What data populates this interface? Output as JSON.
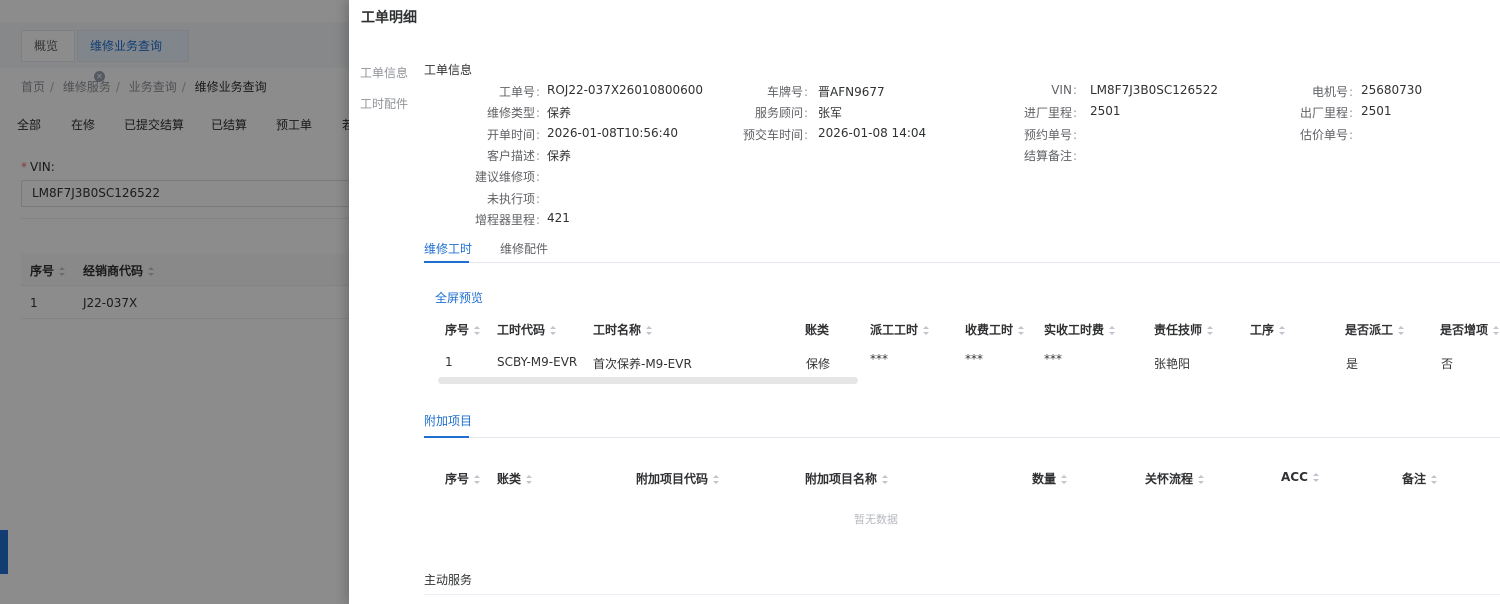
{
  "background": {
    "tabs": [
      {
        "label": "概览"
      },
      {
        "label": "维修业务查询"
      }
    ],
    "breadcrumb": [
      "首页",
      "维修服务",
      "业务查询",
      "维修业务查询"
    ],
    "status_tabs": [
      "全部",
      "在修",
      "已提交结算",
      "已结算",
      "预工单",
      "若"
    ],
    "vin_label": "VIN:",
    "vin_value": "LM8F7J3B0SC126522",
    "table": {
      "headers": [
        "序号",
        "经销商代码"
      ],
      "row": [
        "1",
        "J22-037X"
      ]
    }
  },
  "drawer": {
    "title": "工单明细",
    "nav": [
      "工单信息",
      "工时配件"
    ],
    "section_title": "工单信息",
    "fields": {
      "order_no": {
        "label": "工单号",
        "value": "ROJ22-037X26010800600"
      },
      "plate": {
        "label": "车牌号",
        "value": "晋AFN9677"
      },
      "vin": {
        "label": "VIN",
        "value": "LM8F7J3B0SC126522"
      },
      "motor_no": {
        "label": "电机号",
        "value": "25680730"
      },
      "repair_type": {
        "label": "维修类型",
        "value": "保养"
      },
      "advisor": {
        "label": "服务顾问",
        "value": "张军"
      },
      "in_mileage": {
        "label": "进厂里程",
        "value": "2501"
      },
      "out_mileage": {
        "label": "出厂里程",
        "value": "2501"
      },
      "open_time": {
        "label": "开单时间",
        "value": "2026-01-08T10:56:40"
      },
      "delivery_time": {
        "label": "预交车时间",
        "value": "2026-01-08 14:04"
      },
      "booking_no": {
        "label": "预约单号",
        "value": ""
      },
      "estimate_no": {
        "label": "估价单号",
        "value": ""
      },
      "customer_desc": {
        "label": "客户描述",
        "value": "保养"
      },
      "settle_note": {
        "label": "结算备注",
        "value": ""
      },
      "suggest_item": {
        "label": "建议维修项",
        "value": ""
      },
      "unexecuted": {
        "label": "未执行项",
        "value": ""
      },
      "range_extender": {
        "label": "增程器里程",
        "value": "421"
      }
    },
    "tabs": [
      "维修工时",
      "维修配件"
    ],
    "fullscreen_link": "全屏预览",
    "labor_table": {
      "headers": [
        "序号",
        "工时代码",
        "工时名称",
        "账类",
        "派工工时",
        "收费工时",
        "实收工时费",
        "责任技师",
        "工序",
        "是否派工",
        "是否增项"
      ],
      "rows": [
        [
          "1",
          "SCBY-M9-EVR",
          "首次保养-M9-EVR",
          "保修",
          "***",
          "***",
          "***",
          "张艳阳",
          "",
          "是",
          "否"
        ]
      ]
    },
    "addon": {
      "title": "附加项目",
      "headers": [
        "序号",
        "账类",
        "附加项目代码",
        "附加项目名称",
        "数量",
        "关怀流程",
        "ACC",
        "备注"
      ],
      "empty_text": "暂无数据"
    },
    "main_service": "主动服务"
  }
}
